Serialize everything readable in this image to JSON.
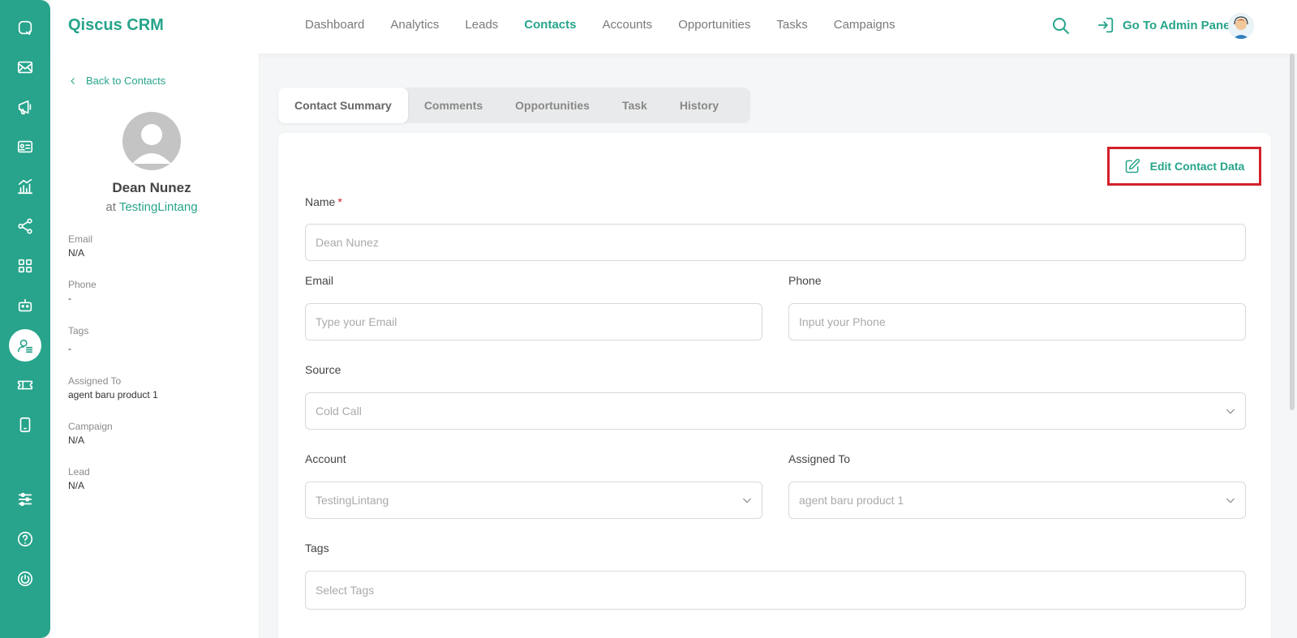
{
  "app": {
    "brand": "Qiscus CRM"
  },
  "rail": {
    "icons": [
      "chat-icon",
      "mail-icon",
      "megaphone-icon",
      "id-card-icon",
      "chart-icon",
      "share-icon",
      "apps-icon",
      "bot-icon",
      "contact-icon",
      "ticket-icon",
      "mobile-icon",
      "sliders-icon",
      "help-icon",
      "power-icon"
    ],
    "active": "contact-icon"
  },
  "nav": {
    "items": [
      "Dashboard",
      "Analytics",
      "Leads",
      "Contacts",
      "Accounts",
      "Opportunities",
      "Tasks",
      "Campaigns"
    ],
    "active": "Contacts",
    "admin_label": "Go To Admin Panel"
  },
  "detail": {
    "back_label": "Back to Contacts",
    "name": "Dean Nunez",
    "at": "at",
    "company": "TestingLintang",
    "fields": [
      {
        "label": "Email",
        "value": "N/A"
      },
      {
        "label": "Phone",
        "value": "-"
      },
      {
        "label": "Tags",
        "value": "-"
      },
      {
        "label": "Assigned To",
        "value": "agent baru product 1"
      },
      {
        "label": "Campaign",
        "value": "N/A"
      },
      {
        "label": "Lead",
        "value": "N/A"
      }
    ]
  },
  "tabs": [
    "Contact Summary",
    "Comments",
    "Opportunities",
    "Task",
    "History"
  ],
  "active_tab": "Contact Summary",
  "form": {
    "edit_label": "Edit Contact Data",
    "name_label": "Name",
    "required_mark": "*",
    "name_value": "Dean Nunez",
    "email_label": "Email",
    "email_placeholder": "Type your Email",
    "phone_label": "Phone",
    "phone_placeholder": "Input your Phone",
    "source_label": "Source",
    "source_value": "Cold Call",
    "account_label": "Account",
    "account_value": "TestingLintang",
    "assigned_label": "Assigned To",
    "assigned_value": "agent baru product 1",
    "tags_label": "Tags",
    "tags_placeholder": "Select Tags"
  },
  "colors": {
    "accent": "#27a48b",
    "highlight": "#d3202a"
  }
}
